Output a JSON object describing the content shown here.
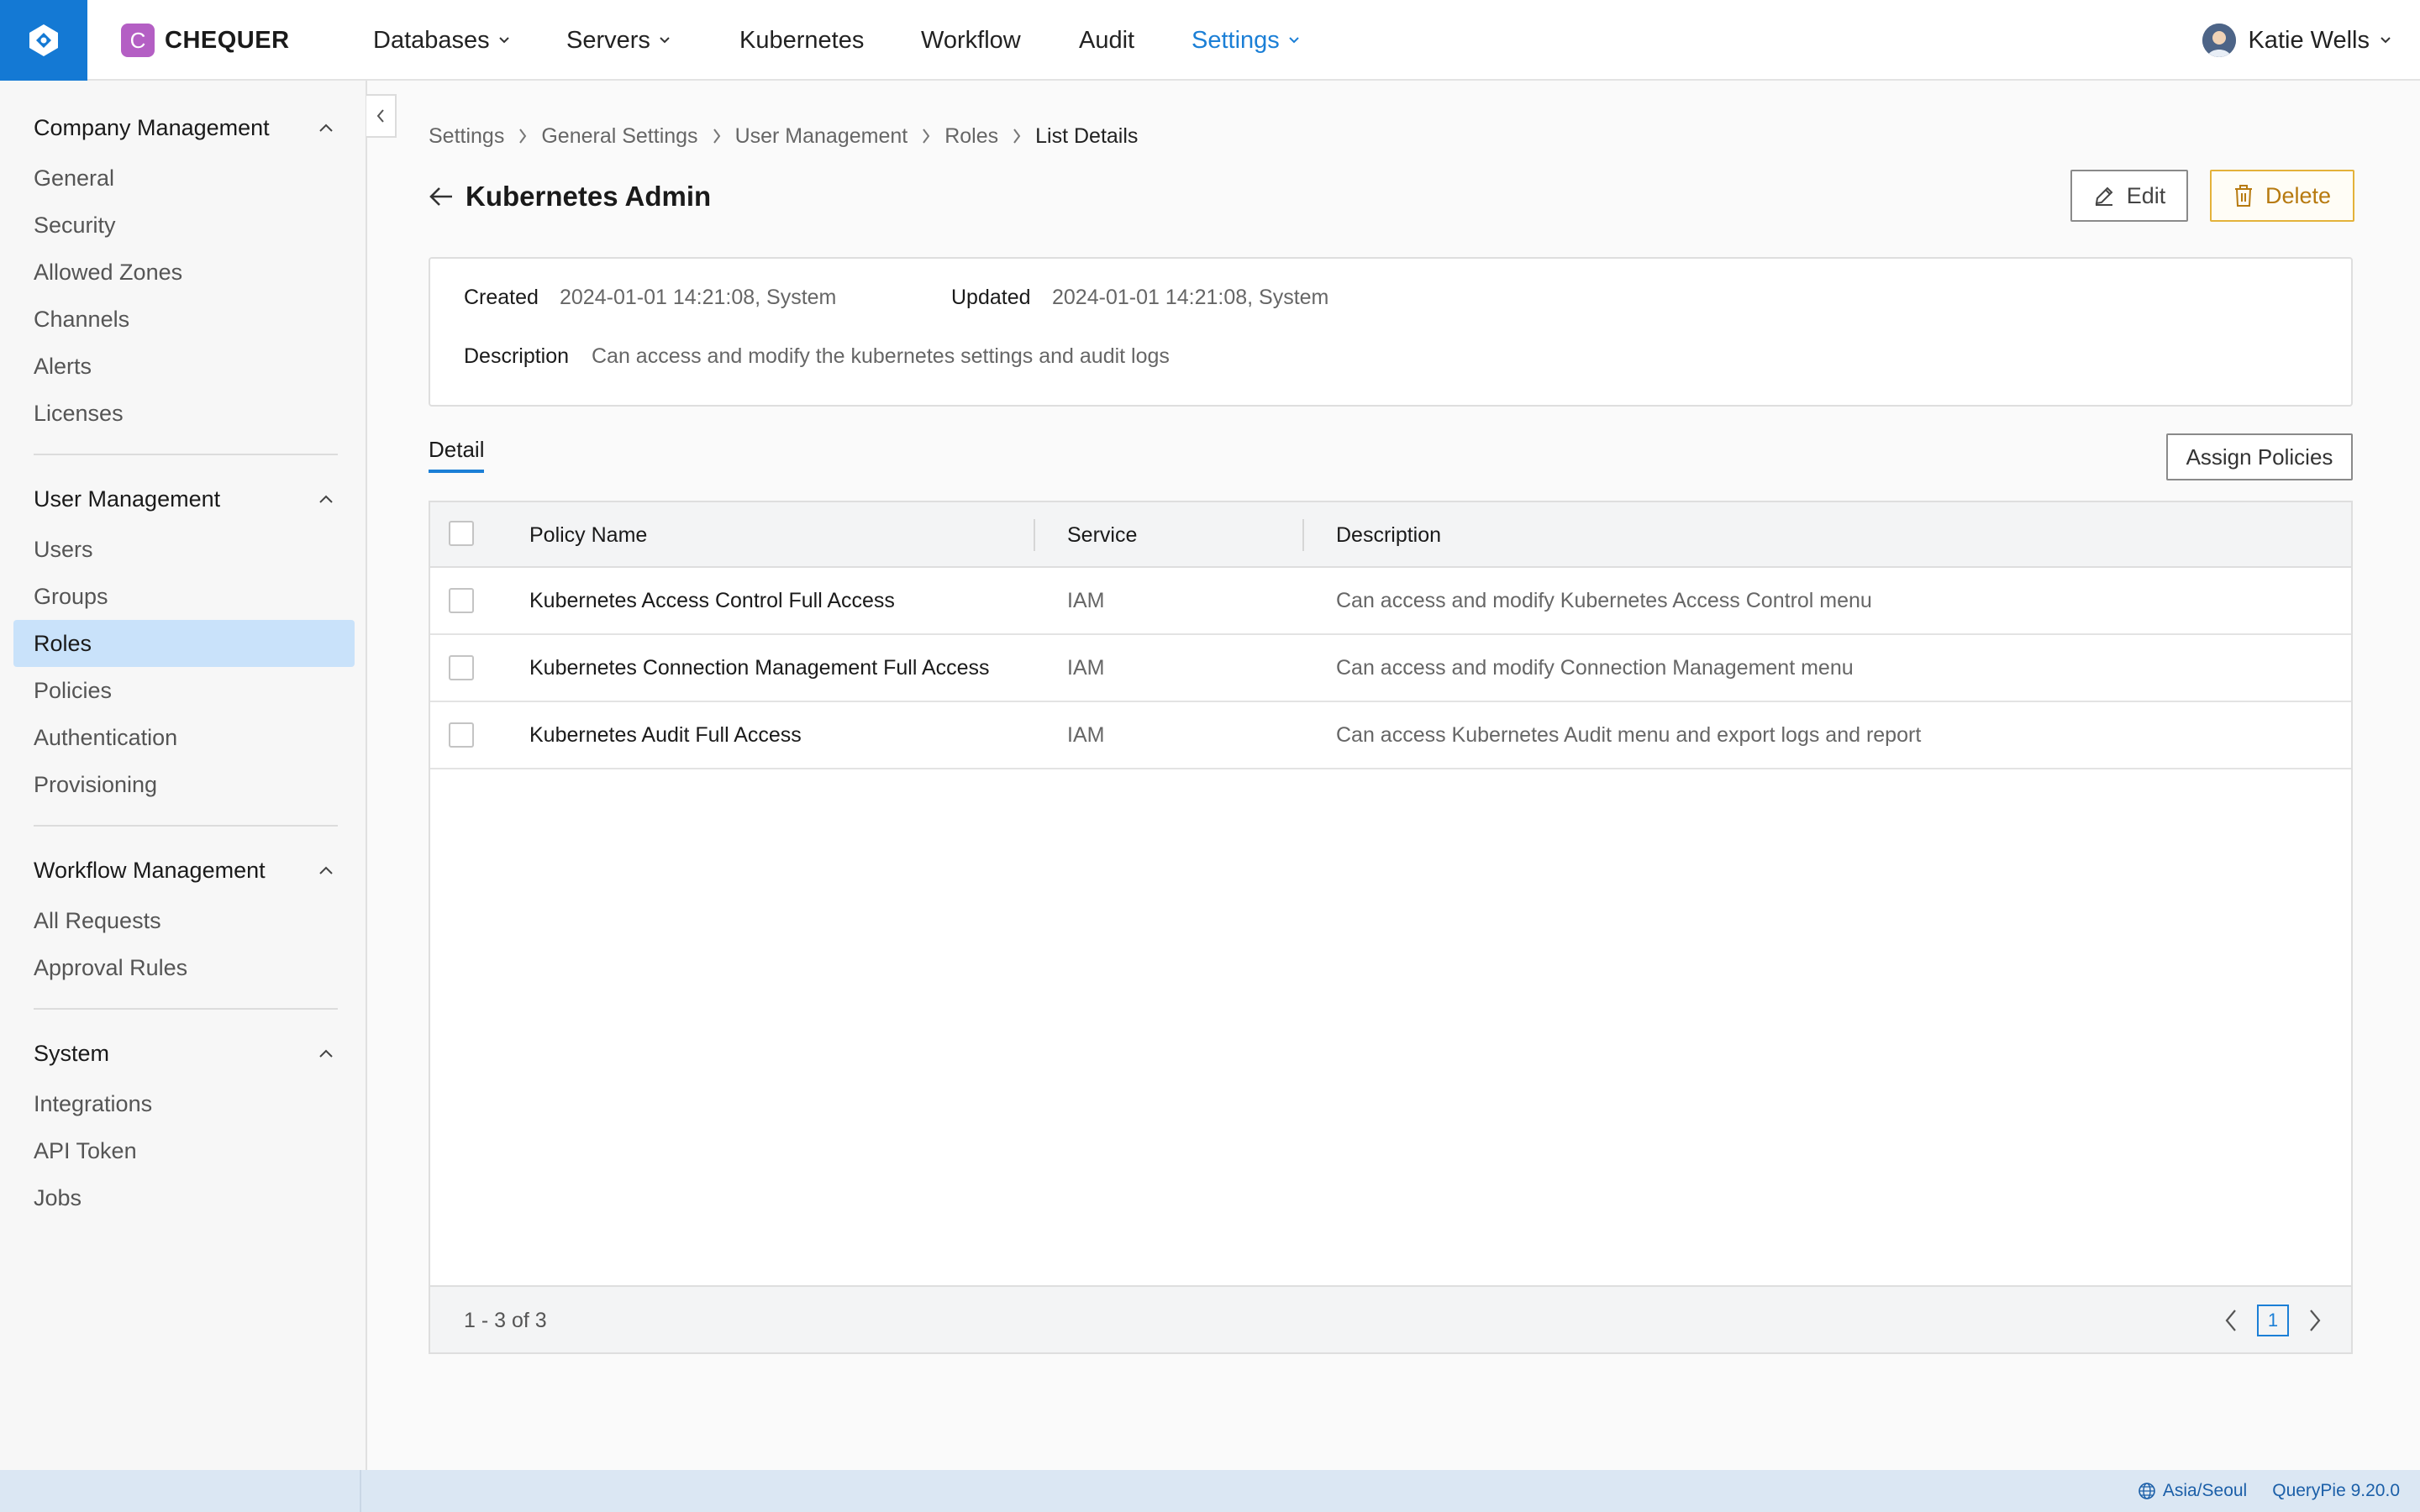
{
  "brand": {
    "badge": "C",
    "name": "CHEQUER"
  },
  "nav": {
    "items": [
      {
        "label": "Databases",
        "dropdown": true
      },
      {
        "label": "Servers",
        "dropdown": true
      },
      {
        "label": "Kubernetes",
        "dropdown": false
      },
      {
        "label": "Workflow",
        "dropdown": false
      },
      {
        "label": "Audit",
        "dropdown": false
      },
      {
        "label": "Settings",
        "dropdown": true,
        "active": true
      }
    ],
    "user_name": "Katie Wells"
  },
  "sidebar": {
    "groups": [
      {
        "title": "Company Management",
        "items": [
          "General",
          "Security",
          "Allowed Zones",
          "Channels",
          "Alerts",
          "Licenses"
        ]
      },
      {
        "title": "User Management",
        "items": [
          "Users",
          "Groups",
          "Roles",
          "Policies",
          "Authentication",
          "Provisioning"
        ]
      },
      {
        "title": "Workflow Management",
        "items": [
          "All Requests",
          "Approval Rules"
        ]
      },
      {
        "title": "System",
        "items": [
          "Integrations",
          "API Token",
          "Jobs"
        ]
      }
    ],
    "active_item": "Roles"
  },
  "breadcrumb": [
    "Settings",
    "General Settings",
    "User Management",
    "Roles",
    "List Details"
  ],
  "page": {
    "title": "Kubernetes Admin",
    "edit_label": "Edit",
    "delete_label": "Delete"
  },
  "info": {
    "created_label": "Created",
    "created_value": "2024-01-01 14:21:08, System",
    "updated_label": "Updated",
    "updated_value": "2024-01-01 14:21:08, System",
    "description_label": "Description",
    "description_value": "Can access and modify the kubernetes settings and audit logs"
  },
  "tabs": {
    "detail": "Detail"
  },
  "assign_label": "Assign Policies",
  "table": {
    "headers": {
      "policy_name": "Policy Name",
      "service": "Service",
      "description": "Description"
    },
    "rows": [
      {
        "policy_name": "Kubernetes Access Control Full Access",
        "service": "IAM",
        "description": "Can access and modify Kubernetes Access Control menu"
      },
      {
        "policy_name": "Kubernetes Connection Management Full Access",
        "service": "IAM",
        "description": "Can access and modify Connection Management menu"
      },
      {
        "policy_name": "Kubernetes Audit Full Access",
        "service": "IAM",
        "description": "Can access Kubernetes Audit menu and export logs and report"
      }
    ],
    "range": "1 - 3 of 3",
    "page": "1"
  },
  "status": {
    "timezone": "Asia/Seoul",
    "version": "QueryPie 9.20.0"
  },
  "colors": {
    "accent": "#1b7fd6",
    "logo_bg": "#1479d4",
    "brand_badge": "#b45fc4",
    "active_side": "#c9e2fa",
    "delete": "#e4b23a"
  }
}
